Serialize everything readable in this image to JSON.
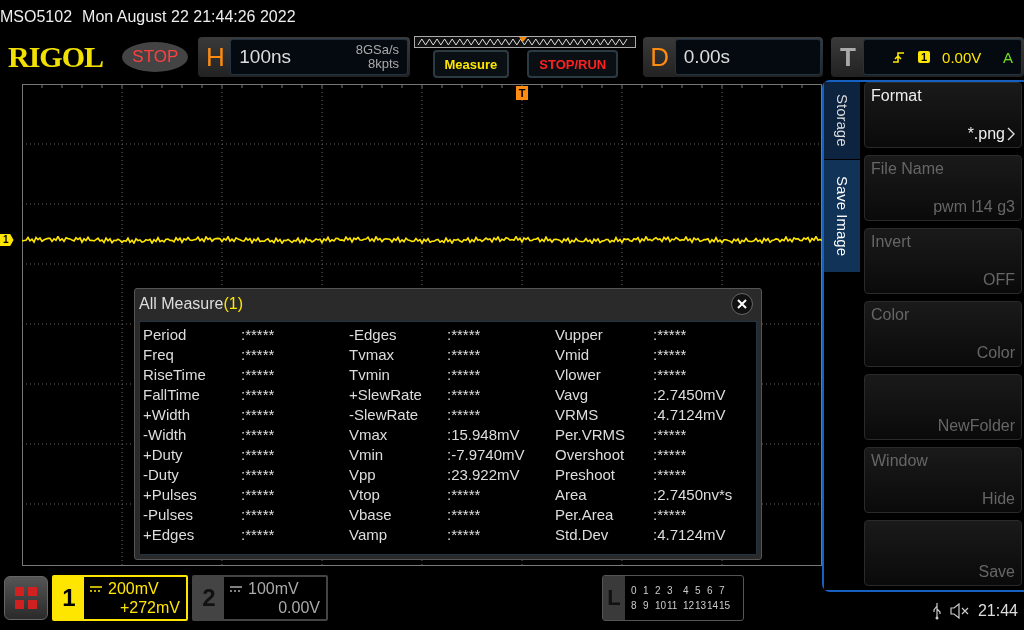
{
  "header": {
    "model": "MSO5102",
    "datetime": "Mon August 22 21:44:26 2022"
  },
  "toolbar": {
    "logo": "RIGOL",
    "run_state": "STOP",
    "horizontal": {
      "label": "H",
      "timebase": "100ns",
      "sample_rate": "8GSa/s",
      "memory_depth": "8kpts"
    },
    "buttons": [
      {
        "label": "Measure",
        "kind": "measure"
      },
      {
        "label": "STOP/RUN",
        "kind": "stoprun"
      }
    ],
    "delay": {
      "label": "D",
      "value": "0.00s"
    },
    "trigger": {
      "label": "T",
      "source": "1",
      "threshold": "0.00V",
      "mode": "A"
    }
  },
  "plot": {
    "channel_marker": "1",
    "trigger_marker": "T"
  },
  "measure_dialog": {
    "title": "All Measure",
    "channel": "(1)",
    "groups": [
      [
        {
          "name": "Period",
          "value": ":*****"
        },
        {
          "name": "Freq",
          "value": ":*****"
        },
        {
          "name": "RiseTime",
          "value": ":*****"
        },
        {
          "name": "FallTime",
          "value": ":*****"
        },
        {
          "name": "+Width",
          "value": ":*****"
        },
        {
          "name": "-Width",
          "value": ":*****"
        },
        {
          "name": "+Duty",
          "value": ":*****"
        },
        {
          "name": "-Duty",
          "value": ":*****"
        },
        {
          "name": "+Pulses",
          "value": ":*****"
        },
        {
          "name": "-Pulses",
          "value": ":*****"
        },
        {
          "name": "+Edges",
          "value": ":*****"
        }
      ],
      [
        {
          "name": "-Edges",
          "value": ":*****"
        },
        {
          "name": "Tvmax",
          "value": ":*****"
        },
        {
          "name": "Tvmin",
          "value": ":*****"
        },
        {
          "name": "+SlewRate",
          "value": ":*****"
        },
        {
          "name": "-SlewRate",
          "value": ":*****"
        },
        {
          "name": "Vmax",
          "value": ":15.948mV"
        },
        {
          "name": "Vmin",
          "value": ":-7.9740mV"
        },
        {
          "name": "Vpp",
          "value": ":23.922mV"
        },
        {
          "name": "Vtop",
          "value": ":*****"
        },
        {
          "name": "Vbase",
          "value": ":*****"
        },
        {
          "name": "Vamp",
          "value": ":*****"
        }
      ],
      [
        {
          "name": "Vupper",
          "value": ":*****"
        },
        {
          "name": "Vmid",
          "value": ":*****"
        },
        {
          "name": "Vlower",
          "value": ":*****"
        },
        {
          "name": "Vavg",
          "value": ":2.7450mV"
        },
        {
          "name": "VRMS",
          "value": ":4.7124mV"
        },
        {
          "name": "Per.VRMS",
          "value": ":*****"
        },
        {
          "name": "Overshoot",
          "value": ":*****"
        },
        {
          "name": "Preshoot",
          "value": ":*****"
        },
        {
          "name": "Area",
          "value": ":2.7450nv*s"
        },
        {
          "name": "Per.Area",
          "value": ":*****"
        },
        {
          "name": "Std.Dev",
          "value": ":4.7124mV"
        }
      ]
    ]
  },
  "side_menu": {
    "tabs": [
      {
        "label": "Storage",
        "selected": false
      },
      {
        "label": "Save Image",
        "selected": true
      }
    ],
    "items": [
      {
        "label": "Format",
        "value": "*.png",
        "disabled": false,
        "submenu": true
      },
      {
        "label": "File Name",
        "value": "pwm l14 g3",
        "disabled": true,
        "submenu": false
      },
      {
        "label": "Invert",
        "value": "OFF",
        "disabled": true,
        "submenu": false
      },
      {
        "label": "Color",
        "value": "Color",
        "disabled": true,
        "submenu": false
      },
      {
        "value": "NewFolder",
        "disabled": true,
        "submenu": false
      },
      {
        "label": "Window",
        "value": "Hide",
        "disabled": true,
        "submenu": false
      },
      {
        "value": "Save",
        "disabled": true,
        "submenu": false
      }
    ]
  },
  "channels": [
    {
      "number": "1",
      "scale": "200mV",
      "offset": "+272mV",
      "selected": true
    },
    {
      "number": "2",
      "scale": "100mV",
      "offset": "0.00V",
      "selected": false
    }
  ],
  "logic": {
    "label": "L",
    "rows": [
      [
        "0",
        "1",
        "2",
        "3",
        "4",
        "5",
        "6",
        "7"
      ],
      [
        "8",
        "9",
        "10",
        "11",
        "12",
        "13",
        "14",
        "15"
      ]
    ]
  },
  "status": {
    "time": "21:44"
  }
}
